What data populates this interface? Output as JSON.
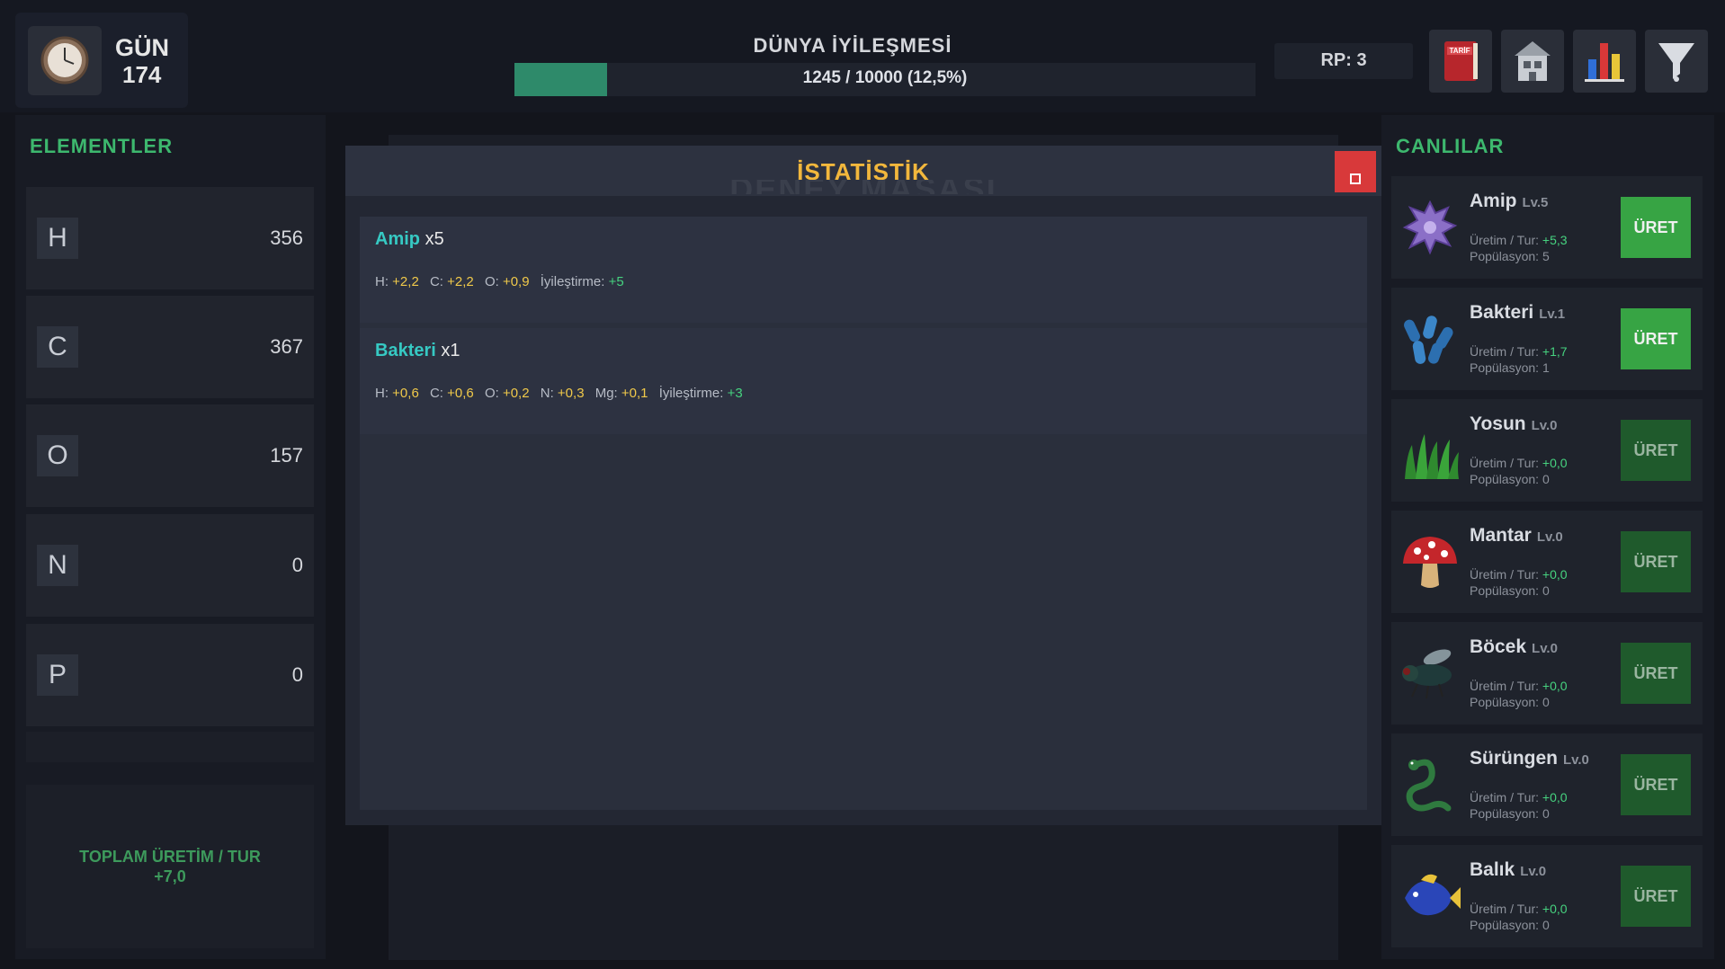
{
  "topbar": {
    "day_label": "GÜN",
    "day_number": "174",
    "world_title": "DÜNYA İYİLEŞMESİ",
    "progress_text": "1245 / 10000 (12,5%)",
    "progress_fraction": 0.1245,
    "rp_text": "RP: 3",
    "buttons": [
      "book-icon",
      "house-icon",
      "bar-chart-icon",
      "funnel-icon"
    ]
  },
  "elements_panel": {
    "title": "ELEMENTLER",
    "items": [
      {
        "symbol": "H",
        "value": "356"
      },
      {
        "symbol": "C",
        "value": "367"
      },
      {
        "symbol": "O",
        "value": "157"
      },
      {
        "symbol": "N",
        "value": "0"
      },
      {
        "symbol": "P",
        "value": "0"
      }
    ],
    "total_label": "TOPLAM ÜRETİM / TUR",
    "total_value": "+7,0"
  },
  "modal": {
    "title": "İSTATİSTİK",
    "ghost_title": "DENEY MASASI",
    "entries": [
      {
        "name": "Amip",
        "count": "x5",
        "stats": [
          {
            "label": "H:",
            "value": "+2,2"
          },
          {
            "label": "C:",
            "value": "+2,2"
          },
          {
            "label": "O:",
            "value": "+0,9"
          }
        ],
        "heal_label": "İyileştirme:",
        "heal_value": "+5"
      },
      {
        "name": "Bakteri",
        "count": "x1",
        "stats": [
          {
            "label": "H:",
            "value": "+0,6"
          },
          {
            "label": "C:",
            "value": "+0,6"
          },
          {
            "label": "O:",
            "value": "+0,2"
          },
          {
            "label": "N:",
            "value": "+0,3"
          },
          {
            "label": "Mg:",
            "value": "+0,1"
          }
        ],
        "heal_label": "İyileştirme:",
        "heal_value": "+3"
      }
    ]
  },
  "creatures_panel": {
    "title": "CANLILAR",
    "rate_label": "Üretim / Tur:",
    "pop_label": "Popülasyon:",
    "button_label": "ÜRET",
    "items": [
      {
        "name": "Amip",
        "level": "Lv.5",
        "rate": "+5,3",
        "population": "5",
        "icon": "amoeba-icon",
        "enabled": true
      },
      {
        "name": "Bakteri",
        "level": "Lv.1",
        "rate": "+1,7",
        "population": "1",
        "icon": "bacteria-icon",
        "enabled": true
      },
      {
        "name": "Yosun",
        "level": "Lv.0",
        "rate": "+0,0",
        "population": "0",
        "icon": "algae-icon",
        "enabled": false
      },
      {
        "name": "Mantar",
        "level": "Lv.0",
        "rate": "+0,0",
        "population": "0",
        "icon": "mushroom-icon",
        "enabled": false
      },
      {
        "name": "Böcek",
        "level": "Lv.0",
        "rate": "+0,0",
        "population": "0",
        "icon": "fly-icon",
        "enabled": false
      },
      {
        "name": "Sürüngen",
        "level": "Lv.0",
        "rate": "+0,0",
        "population": "0",
        "icon": "snake-icon",
        "enabled": false
      },
      {
        "name": "Balık",
        "level": "Lv.0",
        "rate": "+0,0",
        "population": "0",
        "icon": "fish-icon",
        "enabled": false
      }
    ]
  },
  "colors": {
    "accent_green": "#3db86e",
    "title_gold": "#f2b73c",
    "name_cyan": "#36c9c3",
    "value_yellow": "#f0c94a",
    "close_red": "#d8393a"
  }
}
